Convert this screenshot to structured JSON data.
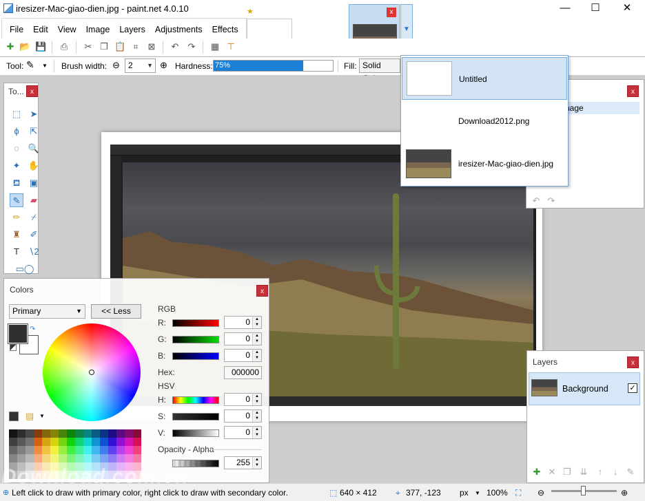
{
  "window": {
    "title": "iresizer-Mac-giao-dien.jpg - paint.net 4.0.10",
    "minimize": "—",
    "maximize": "☐",
    "close": "✕"
  },
  "menu": [
    "File",
    "Edit",
    "View",
    "Image",
    "Layers",
    "Adjustments",
    "Effects"
  ],
  "toolbar2": {
    "tool_label": "Tool:",
    "brush_width_label": "Brush width:",
    "brush_width_value": "2",
    "hardness_label": "Hardness:",
    "hardness_value": "75%",
    "hardness_level": 0.75,
    "fill_label": "Fill:",
    "fill_value": "Solid Colo"
  },
  "document_dropdown": {
    "items": [
      {
        "label": "Untitled"
      },
      {
        "label": "Download2012.png"
      },
      {
        "label": "iresizer-Mac-giao-dien.jpg"
      }
    ]
  },
  "tools_panel": {
    "title": "To..."
  },
  "colors_panel": {
    "title": "Colors",
    "primary_select": "Primary",
    "less_button": "<< Less",
    "rgb_label": "RGB",
    "r_label": "R:",
    "g_label": "G:",
    "b_label": "B:",
    "r_value": "0",
    "g_value": "0",
    "b_value": "0",
    "hex_label": "Hex:",
    "hex_value": "000000",
    "hsv_label": "HSV",
    "h_label": "H:",
    "s_label": "S:",
    "v_label": "V:",
    "h_value": "0",
    "s_value": "0",
    "v_value": "0",
    "opacity_label": "Opacity - Alpha",
    "alpha_value": "255"
  },
  "history_panel": {
    "row_label": "nage"
  },
  "layers_panel": {
    "title": "Layers",
    "layer_name": "Background",
    "layer_visible": true
  },
  "status": {
    "hint": "Left click to draw with primary color, right click to draw with secondary color.",
    "size": "640 × 412",
    "cursor": "377, -123",
    "unit": "px",
    "zoom": "100%"
  },
  "watermark": "Download.com.vn",
  "colors": {
    "accent": "#1c7fd6",
    "close_red": "#c8303a",
    "selection": "#d3e4f7"
  }
}
